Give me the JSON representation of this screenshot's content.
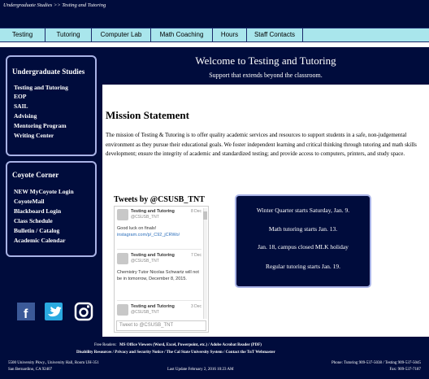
{
  "breadcrumb": "Undergraduate Studies >> Testing and Tutoring",
  "nav": [
    "Testing",
    "Tutoring",
    "Computer Lab",
    "Math Coaching",
    "Hours",
    "Staff Contacts"
  ],
  "sidebar": {
    "undergrad_title": "Undergraduate Studies",
    "undergrad_links": [
      "Testing and Tutoring",
      "EOP",
      "SAIL",
      "Advising",
      "Mentoring Program",
      "Writing Center"
    ],
    "coyote_title": "Coyote Corner",
    "coyote_links": [
      "NEW MyCoyote Login",
      "CoyoteMail",
      "Blackboard Login",
      "Class Schedule",
      "Bulletin / Catalog",
      "Academic Calendar"
    ]
  },
  "header": {
    "welcome": "Welcome to Testing and Tutoring",
    "tagline": "Support that extends beyond the classroom."
  },
  "mission": {
    "title": "Mission Statement",
    "text": "The mission of Testing & Tutoring is to offer quality academic services and resources to support students in a safe, non-judgemental environment as they pursue their educational goals. We foster independent learning and critical thinking through tutoring and math skills development; ensure the integrity of academic and standardized testing; and provide access to computers, printers, and study space."
  },
  "tweets": {
    "title": "Tweets by @CSUSB_TNT",
    "items": [
      {
        "name": "Testing and Tutoring",
        "date": "8 Dec",
        "handle": "@CSUSB_TNT",
        "body": "Good luck on finals!",
        "link": "instagram.com/p/_C92_jCRWo/"
      },
      {
        "name": "Testing and Tutoring",
        "date": "7 Dec",
        "handle": "@CSUSB_TNT",
        "body": "Chemistry Tutor Nicolas Schwartz will not be in tomorrow, December 8, 2015.",
        "link": ""
      },
      {
        "name": "Testing and Tutoring",
        "date": "3 Dec",
        "handle": "@CSUSB_TNT",
        "body": "",
        "link": ""
      }
    ],
    "input_placeholder": "Tweet to @CSUSB_TNT"
  },
  "announcements": [
    "Winter Quarter starts Saturday, Jan. 9.",
    "Math tutoring starts Jan. 13.",
    "Jan. 18, campus closed MLK holiday",
    "Regular tutoring starts Jan. 19."
  ],
  "footer": {
    "free_readers_label": "Free Readers:",
    "free_readers": "MS Office Viewers (Word, Excel, Powerpoint, etc.)   /   Adobe Acrobat Reader (PDF)",
    "links": "Disability Resources   /   Privacy and Security Notice   /   The Cal State University System   /   Contact the TnT Webmaster",
    "address1": "5500 University Pkwy., University Hall, Room UH-351",
    "address2": "San Bernardino, CA 92407",
    "last_update": "Last Update February 2, 2016 10:23 AM",
    "phone": "Phone: Tutoring 909-537-5038 / Testing 909-537-5045",
    "fax": "Fax: 909-537-7187"
  },
  "colors": {
    "navy": "#000c3c",
    "nav_bg": "#a9e6ec",
    "box_border": "#a9b3e6"
  },
  "icons": [
    "facebook-icon",
    "twitter-icon",
    "instagram-icon"
  ]
}
